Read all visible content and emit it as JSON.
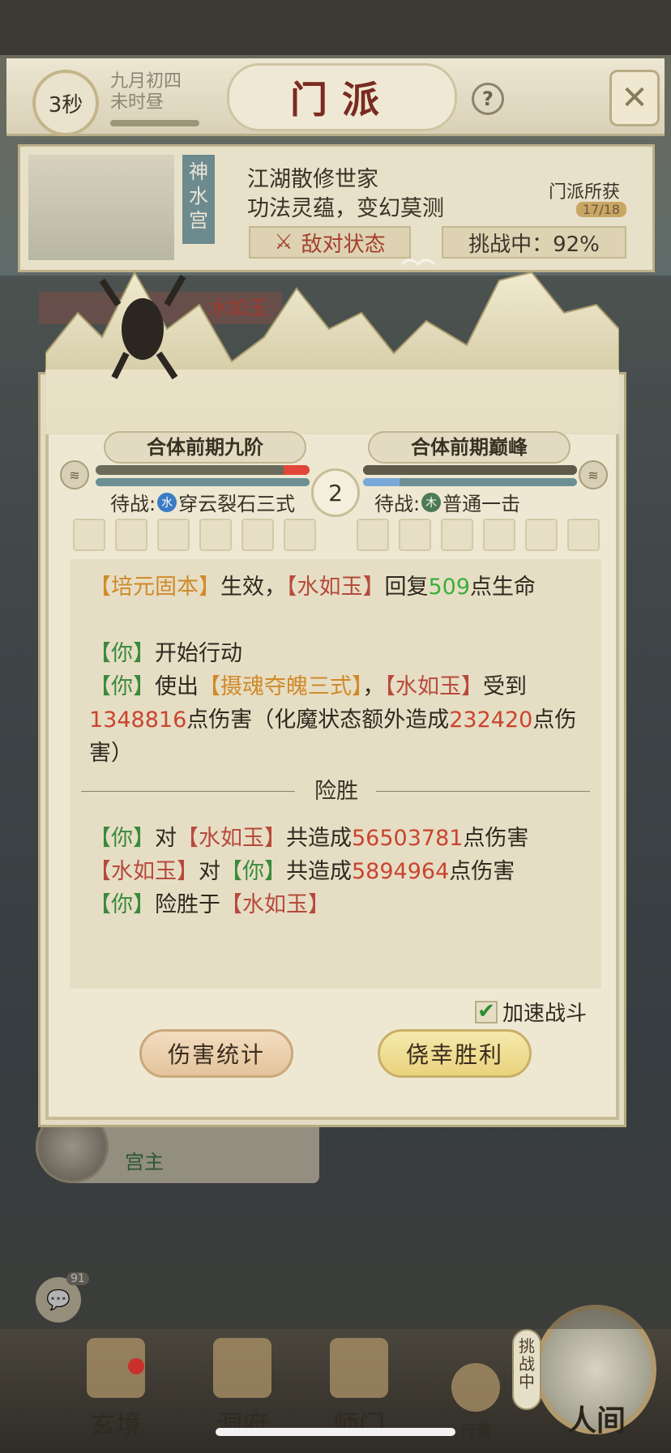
{
  "top_bar": {
    "timer": "3秒",
    "date_line1": "九月初四",
    "date_line2": "未时昼",
    "title": "门派",
    "help_label": "?",
    "close_label": "✕"
  },
  "sect": {
    "banner": "神水宫",
    "line1": "江湖散修世家",
    "line2": "功法灵蕴，变幻莫测",
    "hostile_label": "敌对状态",
    "challenge_label": "挑战中：92%",
    "gain_label": "门派所获",
    "gain_count": "17/18"
  },
  "battle": {
    "left_realm": "合体前期九阶",
    "right_realm": "合体前期巅峰",
    "round": "2",
    "left_hp": 0.12,
    "left_mp": 1.0,
    "right_hp": 1.0,
    "right_mp": 0.17,
    "left_pending_prefix": "待战:",
    "left_element": "水",
    "left_skill": "穿云裂石三式",
    "right_pending_prefix": "待战:",
    "right_element": "木",
    "right_skill": "普通一击",
    "opponent_name": "水如玉"
  },
  "log": {
    "l1_a": "【培元固本】",
    "l1_b": "生效，",
    "l1_c": "【水如玉】",
    "l1_d": "回复",
    "l1_num": "509",
    "l1_e": "点生命",
    "l2_a": "【你】",
    "l2_b": "开始行动",
    "l3_a": "【你】",
    "l3_b": "使出",
    "l3_c": "【摄魂夺魄三式】",
    "l3_d": "，",
    "l3_e": "【水如玉】",
    "l3_f": "受到",
    "l3_num1": "1348816",
    "l3_g": "点伤害（化魔状态额外造成",
    "l3_num2": "232420",
    "l3_h": "点伤害）",
    "divider": "险胜",
    "s1_a": "【你】",
    "s1_b": "对",
    "s1_c": "【水如玉】",
    "s1_d": "共造成",
    "s1_num": "56503781",
    "s1_e": "点伤害",
    "s2_a": "【水如玉】",
    "s2_b": "对",
    "s2_c": "【你】",
    "s2_d": "共造成",
    "s2_num": "5894964",
    "s2_e": "点伤害",
    "s3_a": "【你】",
    "s3_b": "险胜于",
    "s3_c": "【水如玉】"
  },
  "controls": {
    "speed_label": "加速战斗",
    "speed_checked": true,
    "damage_button": "伤害统计",
    "win_button": "侥幸胜利"
  },
  "leader": {
    "role": "宫主"
  },
  "chat": {
    "badge": "91"
  },
  "nav": {
    "items": [
      "玄境",
      "洞府",
      "师门",
      "行囊"
    ],
    "map_label": "人间",
    "challenge_tag": "挑战中"
  },
  "colors": {
    "hp_left": "#e0473a",
    "mp_right": "#7aa9d9",
    "hp_right": "#5d5a4a"
  }
}
